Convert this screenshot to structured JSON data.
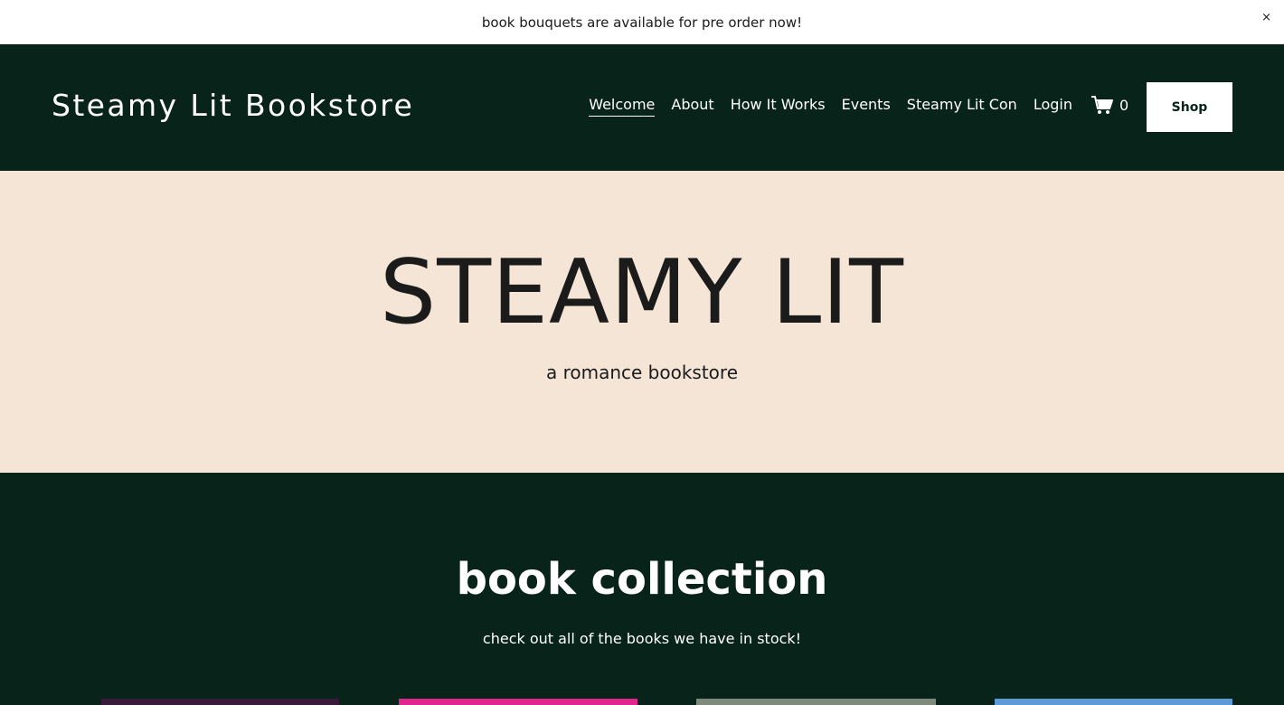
{
  "announcement": {
    "text": "book bouquets are available for pre order now!",
    "close_label": "×"
  },
  "header": {
    "site_title": "Steamy Lit Bookstore",
    "nav": [
      {
        "label": "Welcome",
        "active": true
      },
      {
        "label": "About"
      },
      {
        "label": "How It Works"
      },
      {
        "label": "Events"
      },
      {
        "label": "Steamy Lit Con"
      },
      {
        "label": "Login"
      }
    ],
    "cart_icon": "cart-icon",
    "cart_count": "0",
    "shop_label": "Shop"
  },
  "hero": {
    "title": "STEAMY LIT",
    "subtitle": "a romance bookstore"
  },
  "collection": {
    "title": "book collection",
    "subtitle": "check out all of the books we have in stock!",
    "book_colors": [
      "#3a1a3a",
      "#e0258f",
      "#7d8a7c",
      "#5e9bd6"
    ]
  },
  "colors": {
    "brand_dark": "#08231a",
    "hero_bg": "#f4e5d6",
    "text_dark": "#1b1b1b"
  }
}
